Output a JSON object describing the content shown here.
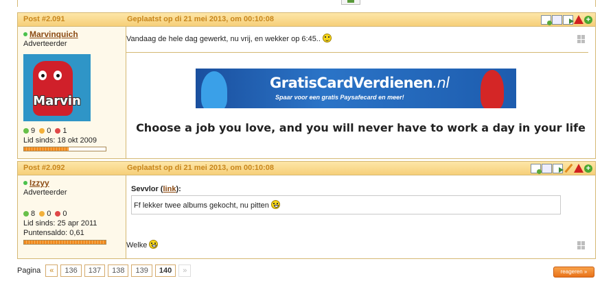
{
  "posts": [
    {
      "number": "Post #2.091",
      "date": "Geplaatst op di 21 mei 2013, om 00:10:08",
      "author": {
        "name": "Marvinquich",
        "role": "Adverteerder",
        "avatar_text": "Marvin",
        "rep_green": "9",
        "rep_yellow": "0",
        "rep_red": "1",
        "member_since": "Lid sinds: 18 okt 2009",
        "activity": 0.55
      },
      "message": "Vandaag de hele dag gewerkt, nu vrij, en wekker op 6:45..",
      "banner": {
        "title_main": "GratisCardVerdienen",
        "title_tld": ".nl",
        "subtitle": "Spaar voor een gratis Paysafecard en meer!"
      },
      "signature": "Choose a job you love, and you will never have to work a day in your life"
    },
    {
      "number": "Post #2.092",
      "date": "Geplaatst op di 21 mei 2013, om 00:10:08",
      "author": {
        "name": "Izzyy",
        "role": "Adverteerder",
        "rep_green": "8",
        "rep_yellow": "0",
        "rep_red": "0",
        "member_since": "Lid sinds: 25 apr 2011",
        "points": "Puntensaldo: 0,61",
        "activity": 1.0
      },
      "quote_author": "Sevvlor",
      "quote_link": "link",
      "quote_text": "Ff lekker twee albums gekocht, nu pitten",
      "message": "Welke"
    }
  ],
  "icons": [
    "note-add-icon",
    "multiquote-icon",
    "quote-icon",
    "edit-pencil-icon",
    "report-warning-icon",
    "add-icon",
    "smiley-icon",
    "windows-icon"
  ],
  "colors": {
    "header_bg": "#f6cf79",
    "header_text": "#c8861c",
    "sidebar_bg": "#fef9ea",
    "username": "#8b4a12",
    "reply_button": "#e8721a"
  },
  "pagination": {
    "label": "Pagina",
    "prev": "«",
    "pages": [
      "136",
      "137",
      "138",
      "139",
      "140"
    ],
    "current": "140",
    "next": "»"
  },
  "reply_button": "reageren »"
}
